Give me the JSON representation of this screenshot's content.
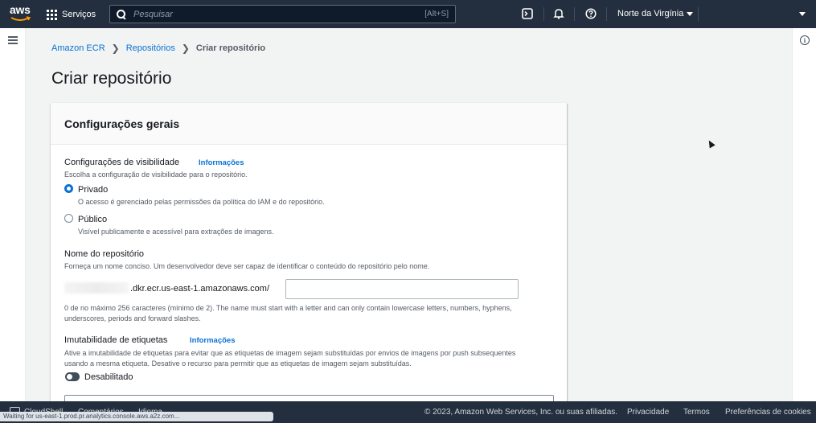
{
  "topnav": {
    "logo": "aws",
    "services_label": "Serviços",
    "search_placeholder": "Pesquisar",
    "search_shortcut": "[Alt+S]",
    "region": "Norte da Virgínia"
  },
  "breadcrumb": {
    "items": [
      "Amazon ECR",
      "Repositórios"
    ],
    "current": "Criar repositório"
  },
  "page_title": "Criar repositório",
  "panel": {
    "header": "Configurações gerais",
    "visibility": {
      "label": "Configurações de visibilidade",
      "info": "Informações",
      "description": "Escolha a configuração de visibilidade para o repositório.",
      "options": [
        {
          "label": "Privado",
          "description": "O acesso é gerenciado pelas permissões da política do IAM e do repositório.",
          "selected": true
        },
        {
          "label": "Público",
          "description": "Visível publicamente e acessível para extrações de imagens.",
          "selected": false
        }
      ]
    },
    "repo_name": {
      "label": "Nome do repositório",
      "description": "Forneça um nome conciso. Um desenvolvedor deve ser capaz de identificar o conteúdo do repositório pelo nome.",
      "uri_suffix": ".dkr.ecr.us-east-1.amazonaws.com/",
      "value": "",
      "constraint_line1": "0 de no máximo 256 caracteres (mínimo de 2). The name must start with a letter and can only contain lowercase letters, numbers, hyphens,",
      "constraint_line2": "underscores, periods and forward slashes."
    },
    "tag_immutability": {
      "label": "Imutabilidade de etiquetas",
      "info": "Informações",
      "description_line1": "Ative a imutabilidade de etiquetas para evitar que as etiquetas de imagem sejam substituídas por envios de imagens por push subsequentes",
      "description_line2": "usando a mesma etiqueta. Desative o recurso para permitir que as etiquetas de imagem sejam substituídas.",
      "toggle_label": "Desabilitado",
      "enabled": false
    }
  },
  "footer": {
    "cloudshell": "CloudShell",
    "feedback": "Comentários",
    "language": "Idioma",
    "copyright": "© 2023, Amazon Web Services, Inc. ou suas afiliadas.",
    "privacy": "Privacidade",
    "terms": "Termos",
    "cookies": "Preferências de cookies",
    "status": "Waiting for us-east-1.prod.pr.analytics.console.aws.a2z.com..."
  },
  "colors": {
    "nav_bg": "#232f3e",
    "link": "#0972d3",
    "page_bg": "#f2f3f3"
  }
}
